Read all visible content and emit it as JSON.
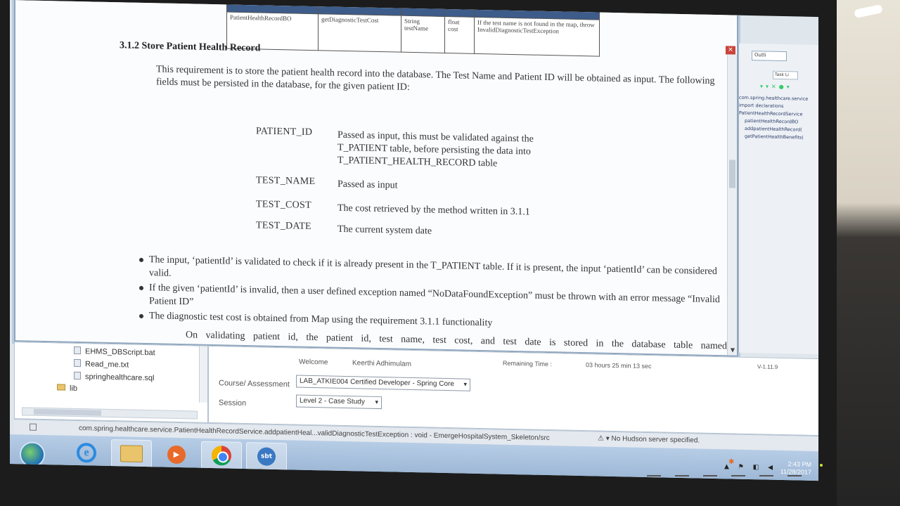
{
  "doc": {
    "method_table": {
      "headers": [
        "",
        "",
        "",
        "",
        ""
      ],
      "row": [
        "PatientHealthRecordBO",
        "getDiagnosticTestCost",
        "String testName",
        "float cost",
        "If the test name is not found in the map, throw InvalidDiagnosticTestException"
      ]
    },
    "section_heading": "3.1.2 Store Patient Health Record",
    "intro": "This requirement is to store the patient health record into the database. The Test Name and Patient ID will be obtained as input. The following fields must be persisted in the database, for the given patient ID:",
    "fields": [
      {
        "name": "PATIENT_ID",
        "desc": "Passed as input, this must be validated against the T_PATIENT table, before persisting the data into T_PATIENT_HEALTH_RECORD table"
      },
      {
        "name": "TEST_NAME",
        "desc": "Passed as input"
      },
      {
        "name": "TEST_COST",
        "desc": "The cost retrieved by the method written in 3.1.1"
      },
      {
        "name": "TEST_DATE",
        "desc": "The current system date"
      }
    ],
    "bullets": [
      "The input, ‘patientId’ is validated to check if it is already present in the T_PATIENT table. If it is present, the input ‘patientId’ can be considered valid.",
      "If the given ‘patientId’ is invalid, then a user defined exception named “NoDataFoundException” must be thrown with an error message “Invalid Patient ID”",
      "The diagnostic test cost is obtained from Map using the requirement 3.1.1 functionality"
    ],
    "last_line": "On validating patient id, the patient id, test name, test cost, and test date is stored in the database table named"
  },
  "outline": {
    "tab1": "Outli",
    "tab2": "Task Li",
    "tree": [
      "com.spring.healthcare.service",
      "import declarations",
      "PatientHealthRecordService",
      "patientHealthRecordBO",
      "addpatientHealthRecord(",
      "getPatientHealthBenefits("
    ]
  },
  "project": {
    "items": [
      "EHMS_DBScript.bat",
      "Read_me.txt",
      "springhealthcare.sql",
      "lib"
    ]
  },
  "assessment": {
    "welcome_label": "Welcome",
    "user_name": "Keerthi Adhimulam",
    "remaining_label": "Remaining Time :",
    "remaining_value": "03 hours 25 min 13 sec",
    "version": "V-1.11.9",
    "course_label": "Course/ Assessment",
    "course_value": "LAB_ATKIE004 Certified Developer - Spring Core",
    "session_label": "Session",
    "session_value": "Level 2 - Case Study"
  },
  "statusbar": {
    "path": "com.spring.healthcare.service.PatientHealthRecordService.addpatientHeal...validDiagnosticTestException : void - EmergeHospitalSystem_Skeleton/src",
    "hudson": "No Hudson server specified."
  },
  "taskbar": {
    "sbt_label": "sbt",
    "media_label": "▶",
    "clock_time": "2:43 PM",
    "clock_date": "11/28/2017"
  }
}
